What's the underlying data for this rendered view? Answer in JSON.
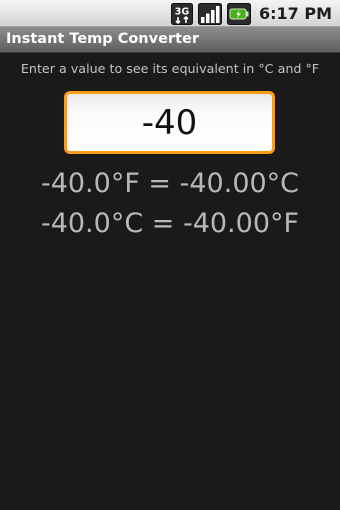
{
  "status_bar": {
    "network_label": "3G",
    "time": "6:17 PM"
  },
  "app": {
    "title": "Instant Temp Converter"
  },
  "main": {
    "instructions": "Enter a value to see its equivalent in °C and °F",
    "input_value": "-40",
    "result_f_to_c": "-40.0°F = -40.00°C",
    "result_c_to_f": "-40.0°C = -40.00°F"
  },
  "icons": [
    "network-3g-icon",
    "signal-strength-icon",
    "battery-icon"
  ],
  "colors": {
    "input_focus_ring": "#ff9c16",
    "background": "#1a1a1a",
    "title_bar": "#707070",
    "result_text": "#b8b8b8",
    "battery": "#4cae1f"
  }
}
